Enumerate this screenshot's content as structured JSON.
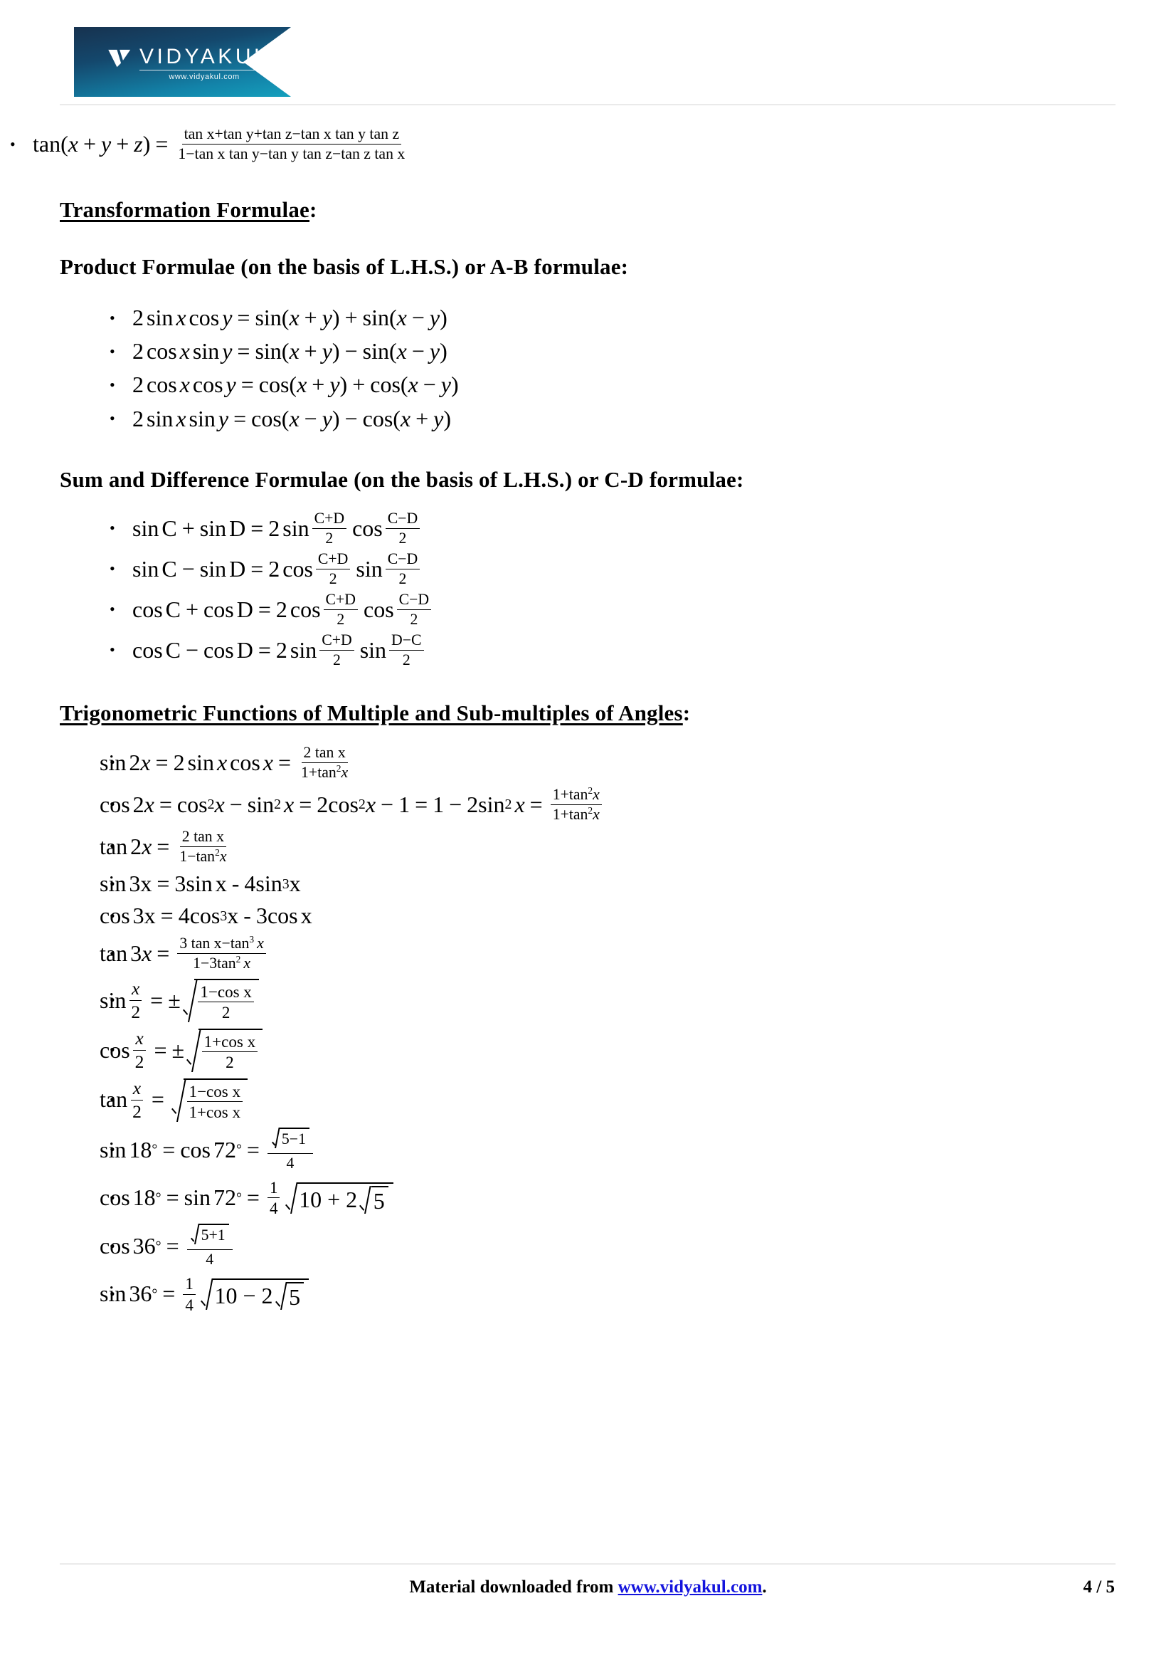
{
  "header": {
    "logo_word": "VIDYAKUL",
    "logo_url": "www.vidyakul.com"
  },
  "content": {
    "top_formula": {
      "lhs": "tan(x + y + z)",
      "equals": "=",
      "numerator": "tan x+tan y+tan z−tan x tan y tan z",
      "denominator": "1−tan x tan y−tan y tan z−tan z tan x"
    },
    "headings": {
      "transformation": "Transformation Formulae",
      "transformation_colon": ":",
      "product": "Product Formulae (on the basis of L.H.S.) or A-B formulae:",
      "sum_difference": "Sum and Difference Formulae (on the basis of L.H.S.) or C-D formulae:",
      "multiple_angles": "Trigonometric Functions of Multiple and Sub-multiples of Angles",
      "multiple_angles_colon": ":"
    },
    "product_formulae": [
      "2 sin x cos y = sin(x + y) + sin(x − y)",
      "2 cos x sin y = sin(x + y) − sin(x − y)",
      "2 cos x cos y = cos(x + y) + cos(x − y)",
      "2 sin x sin y = cos(x − y) − cos(x + y)"
    ],
    "cd_formulae": [
      "sin C + sin D = 2 sin (C+D)/2 cos (C−D)/2",
      "sin C − sin D = 2 cos (C+D)/2 sin (C−D)/2",
      "cos C + cos D = 2 cos (C+D)/2 cos (C−D)/2",
      "cos C − cos D = 2 sin (C+D)/2 sin (D−C)/2"
    ],
    "multiple_formulae": [
      "sin 2x = 2 sin x cos x = 2 tan x / (1+tan²x)",
      "cos 2x = cos²x − sin²x = 2cos²x − 1 = 1 − 2sin²x = (1+tan²x)/(1+tan²x)",
      "tan 2x = 2 tan x / (1−tan²x)",
      "sin 3x = 3sin x  - 4sin³x",
      "cos 3x = 4cos³x - 3cos x",
      "tan 3x = (3 tan x−tan³x)/(1−3tan²x)",
      "sin x/2 = ±√((1−cos x)/2)",
      "cos x/2 = ±√((1+cos x)/2)",
      "tan x/2 = √((1−cos x)/(1+cos x))",
      "sin 18° = cos 72° = (√5−1)/4",
      "cos 18° = sin 72° = ¼√(10 + 2√5)",
      "cos 36° = (√5+1)/4",
      "sin 36° = ¼√(10 − 2√5)"
    ],
    "tokens": {
      "sin": "sin",
      "cos": "cos",
      "tan": "tan",
      "two": "2",
      "three": "3",
      "one": "1",
      "four": "4",
      "five": "5",
      "ten": "10",
      "eq": "=",
      "plus": "+",
      "minus": "−",
      "hyphen": "-",
      "pm": "±",
      "x": "x",
      "y": "y",
      "z": "z",
      "C": "C",
      "D": "D",
      "lparen": "(",
      "rparen": ")",
      "deg": "°",
      "n18": "18",
      "n72": "72",
      "n36": "36",
      "CplusD": "C+D",
      "CminusD": "C−D",
      "DminusC": "D−C",
      "num_top": "tan x+tan y+tan z−tan x tan y tan z",
      "num_bot": "1−tan x tan y−tan y tan z−tan z tan x",
      "two_tan_x": "2 tan x",
      "one_plus_tan2x": "1+tan",
      "one_minus_tan2x": "1−tan",
      "one_minus_3tan2x": "1−3tan",
      "three_tan_x": "3 tan x",
      "minus_tan3x": "−tan",
      "one_minus_cos_x": "1−cos x",
      "one_plus_cos_x": "1+cos x",
      "sqrt5_minus_1": "5−1",
      "sqrt5_plus_1": "5+1",
      "ten_plus_2": "10 + 2",
      "ten_minus_2": "10 − 2"
    }
  },
  "footer": {
    "text_prefix": "Material downloaded from ",
    "link": "www.vidyakul.com",
    "text_suffix": ".",
    "page": "4 / 5"
  }
}
